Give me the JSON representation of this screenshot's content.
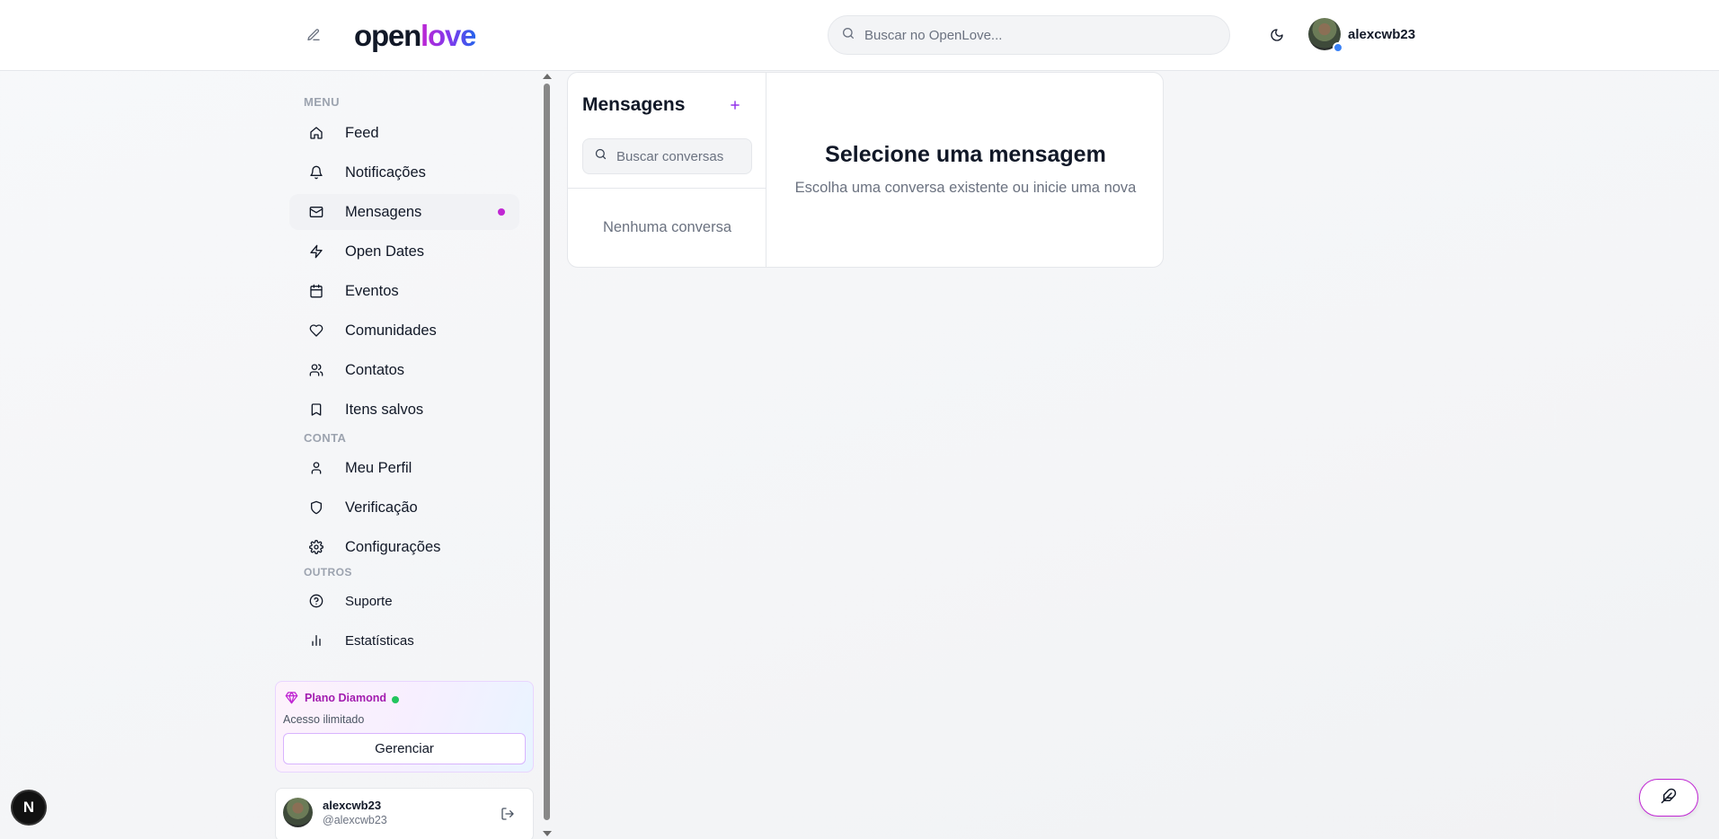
{
  "header": {
    "logo_part1": "open",
    "logo_part2": "love",
    "search_placeholder": "Buscar no OpenLove...",
    "username": "alexcwb23"
  },
  "sidebar": {
    "sections": {
      "menu": "MENU",
      "conta": "CONTA",
      "outros": "OUTROS"
    },
    "menu_items": [
      {
        "label": "Feed",
        "icon": "home-icon"
      },
      {
        "label": "Notificações",
        "icon": "bell-icon"
      },
      {
        "label": "Mensagens",
        "icon": "mail-icon",
        "active": true,
        "unread": true
      },
      {
        "label": "Open Dates",
        "icon": "lightning-icon"
      },
      {
        "label": "Eventos",
        "icon": "calendar-icon"
      },
      {
        "label": "Comunidades",
        "icon": "heart-icon"
      },
      {
        "label": "Contatos",
        "icon": "users-icon"
      },
      {
        "label": "Itens salvos",
        "icon": "bookmark-icon"
      }
    ],
    "conta_items": [
      {
        "label": "Meu Perfil",
        "icon": "user-icon"
      },
      {
        "label": "Verificação",
        "icon": "shield-icon"
      },
      {
        "label": "Configurações",
        "icon": "gear-icon"
      }
    ],
    "outros_items": [
      {
        "label": "Suporte",
        "icon": "help-circle-icon"
      },
      {
        "label": "Estatísticas",
        "icon": "bar-chart-icon"
      }
    ],
    "plan": {
      "title": "Plano Diamond",
      "subtitle": "Acesso ilimitado",
      "button": "Gerenciar"
    },
    "user": {
      "name": "alexcwb23",
      "handle": "@alexcwb23"
    }
  },
  "messages": {
    "title": "Mensagens",
    "search_placeholder": "Buscar conversas",
    "empty_list": "Nenhuma conversa",
    "empty_title": "Selecione uma mensagem",
    "empty_subtitle": "Escolha uma conversa existente ou inicie uma nova"
  },
  "floating": {
    "dev_badge": "N"
  },
  "colors": {
    "accent": "#c026d3",
    "status_online": "#22c55e",
    "verified": "#3b82f6"
  }
}
